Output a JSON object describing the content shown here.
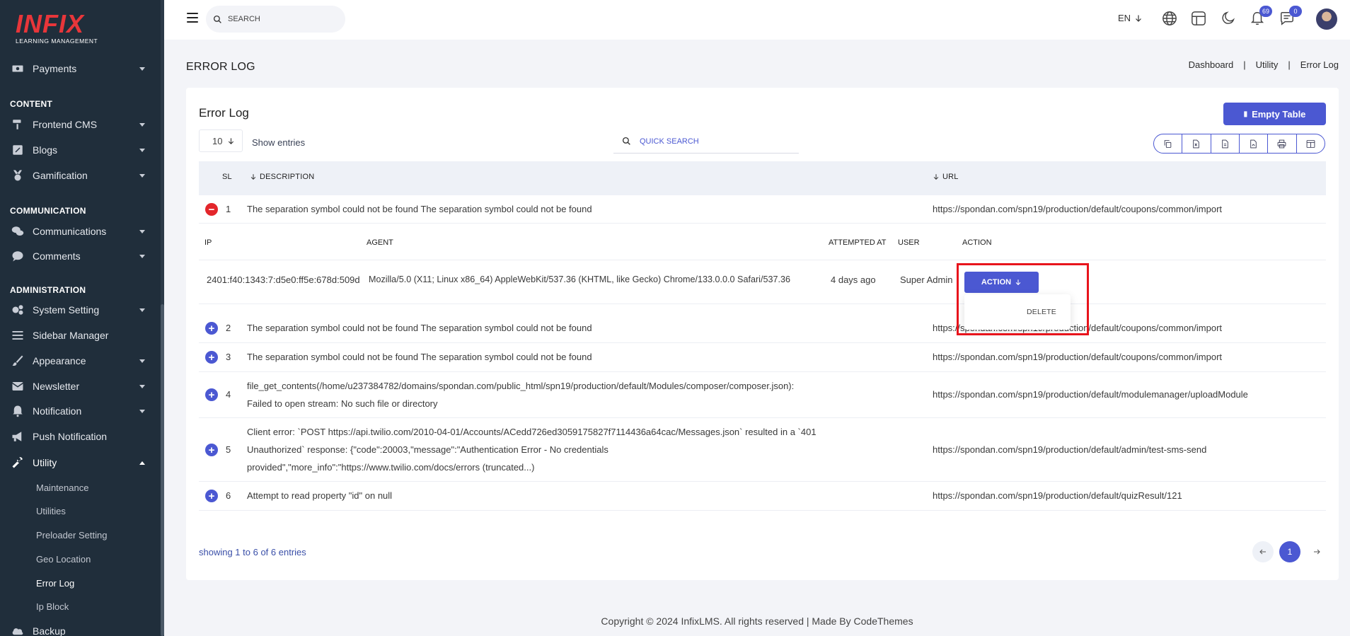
{
  "brand": {
    "logo_text": "INFIX",
    "logo_sub": "LEARNING MANAGEMENT"
  },
  "sidebar": {
    "top_item": {
      "label": "Payments"
    },
    "sections": {
      "content": "CONTENT",
      "communication": "COMMUNICATION",
      "administration": "ADMINISTRATION"
    },
    "items": [
      {
        "label": "Frontend CMS"
      },
      {
        "label": "Blogs"
      },
      {
        "label": "Gamification"
      },
      {
        "label": "Communications"
      },
      {
        "label": "Comments"
      },
      {
        "label": "System Setting"
      },
      {
        "label": "Sidebar Manager"
      },
      {
        "label": "Appearance"
      },
      {
        "label": "Newsletter"
      },
      {
        "label": "Notification"
      },
      {
        "label": "Push Notification"
      },
      {
        "label": "Utility"
      },
      {
        "label": "Backup"
      }
    ],
    "utility_sub": [
      {
        "label": "Maintenance"
      },
      {
        "label": "Utilities"
      },
      {
        "label": "Preloader Setting"
      },
      {
        "label": "Geo Location"
      },
      {
        "label": "Error Log"
      },
      {
        "label": "Ip Block"
      }
    ]
  },
  "topbar": {
    "search_placeholder": "SEARCH",
    "language": "EN",
    "notification_count": "69",
    "message_count": "0"
  },
  "page": {
    "title": "ERROR LOG",
    "breadcrumb": [
      "Dashboard",
      "Utility",
      "Error Log"
    ],
    "breadcrumb_separator": "|"
  },
  "card": {
    "title": "Error Log",
    "empty_button": "Empty Table",
    "entries_value": "10",
    "entries_label": "Show entries",
    "quick_search_placeholder": "QUICK SEARCH"
  },
  "table": {
    "headers": {
      "sl": "SL",
      "description": "DESCRIPTION",
      "url": "URL"
    },
    "rows": [
      {
        "sl": "1",
        "description": "The separation symbol could not be found The separation symbol could not be found",
        "url": "https://spondan.com/spn19/production/default/coupons/common/import"
      },
      {
        "sl": "2",
        "description": "The separation symbol could not be found The separation symbol could not be found",
        "url": "https://spondan.com/spn19/production/default/coupons/common/import"
      },
      {
        "sl": "3",
        "description": "The separation symbol could not be found The separation symbol could not be found",
        "url": "https://spondan.com/spn19/production/default/coupons/common/import"
      },
      {
        "sl": "4",
        "description_line1": "file_get_contents(/home/u237384782/domains/spondan.com/public_html/spn19/production/default/Modules/composer/composer.json):",
        "description_line2": "Failed to open stream: No such file or directory",
        "url": "https://spondan.com/spn19/production/default/modulemanager/uploadModule"
      },
      {
        "sl": "5",
        "description_line1": "Client error: `POST https://api.twilio.com/2010-04-01/Accounts/ACedd726ed3059175827f7114436a64cac/Messages.json` resulted in a `401",
        "description_line2": "Unauthorized` response: {\"code\":20003,\"message\":\"Authentication Error - No credentials",
        "description_line3": "provided\",\"more_info\":\"https://www.twilio.com/docs/errors (truncated...)",
        "url": "https://spondan.com/spn19/production/default/admin/test-sms-send"
      },
      {
        "sl": "6",
        "description": "Attempt to read property \"id\" on null",
        "url": "https://spondan.com/spn19/production/default/quizResult/121"
      }
    ],
    "expanded": {
      "headers": {
        "ip": "IP",
        "agent": "AGENT",
        "attempted_at": "ATTEMPTED AT",
        "user": "USER",
        "action": "ACTION"
      },
      "ip": "2401:f40:1343:7:d5e0:ff5e:678d:509d",
      "agent": "Mozilla/5.0 (X11; Linux x86_64) AppleWebKit/537.36 (KHTML, like Gecko) Chrome/133.0.0.0 Safari/537.36",
      "attempted_at": "4 days ago",
      "user": "Super Admin",
      "action_button": "ACTION",
      "dropdown_item": "DELETE"
    }
  },
  "pagination": {
    "info": "showing 1 to 6 of 6 entries",
    "current": "1"
  },
  "footer": {
    "copyright": "Copyright © 2024 InfixLMS. All rights reserved | Made By CodeThemes"
  },
  "colors": {
    "sidebar_bg": "#202e3b",
    "accent": "#4b58d2",
    "danger": "#e3262b",
    "highlight": "#e8141c"
  }
}
